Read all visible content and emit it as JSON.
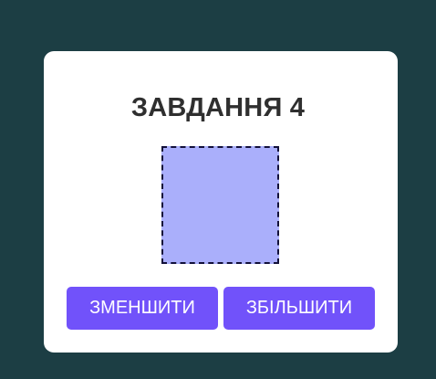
{
  "task": {
    "title": "ЗАВДАННЯ 4",
    "box_color": "#aaaffb",
    "box_border_color": "#12103a",
    "buttons": {
      "decrease_label": "ЗМЕНШИТИ",
      "increase_label": "ЗБІЛЬШИТИ",
      "color": "#7152fa"
    }
  },
  "background_color": "#1c3e44"
}
